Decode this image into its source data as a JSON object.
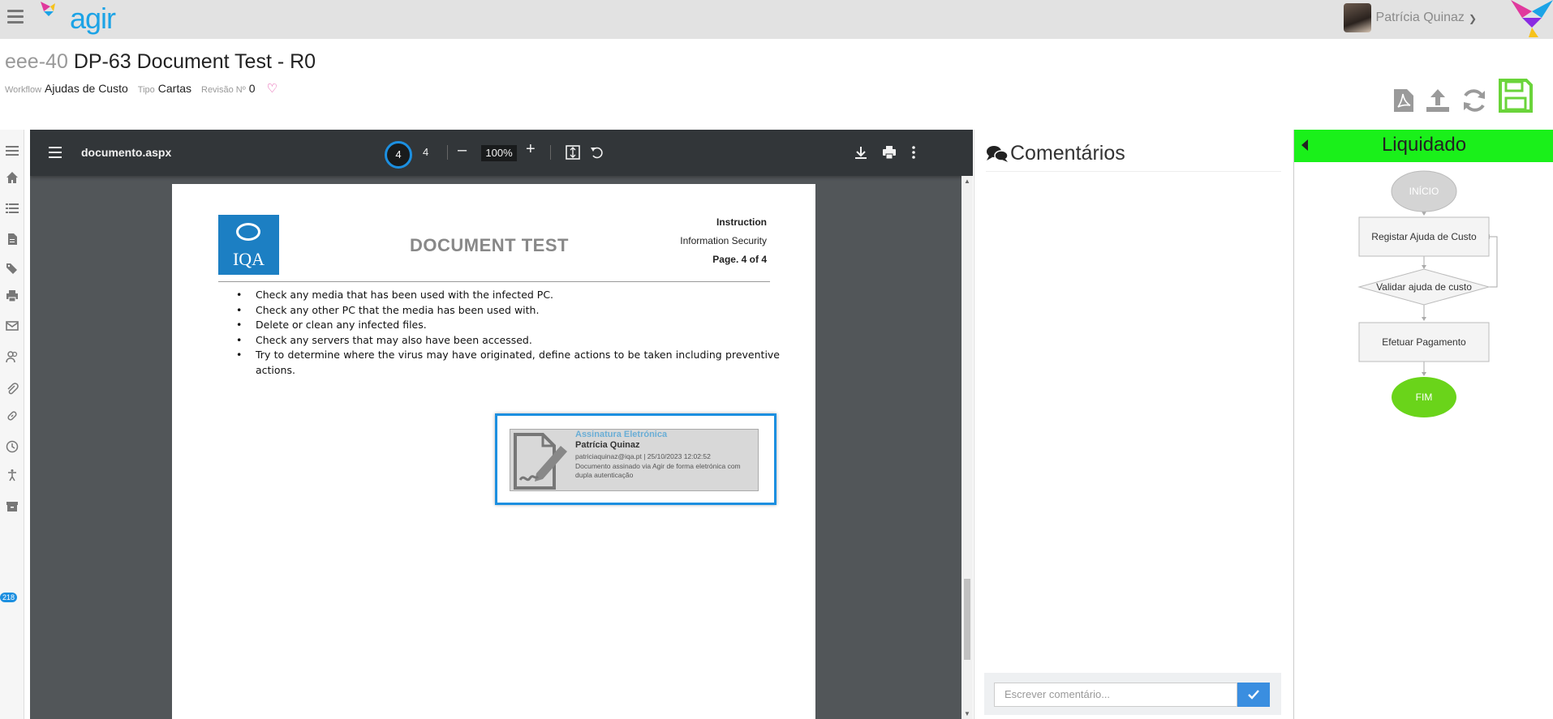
{
  "header": {
    "logo_text": "agir",
    "user_name": "Patrícia Quinaz"
  },
  "document": {
    "code": "eee-40",
    "title": "DP-63 Document Test - R0",
    "workflow_label": "Workflow",
    "workflow_value": "Ajudas de Custo",
    "type_label": "Tipo",
    "type_value": "Cartas",
    "revision_label": "Revisão Nº",
    "revision_value": "0"
  },
  "pdf_viewer": {
    "filename": "documento.aspx",
    "current_page": "4",
    "total_pages": "4",
    "zoom": "100%",
    "page": {
      "logo_text": "IQA",
      "title": "DOCUMENT TEST",
      "header_right_1": "Instruction",
      "header_right_2": "Information Security",
      "header_right_3_prefix": "Page. ",
      "header_right_3_page": "4",
      "header_right_3_mid": " of ",
      "header_right_3_total": "4",
      "bullets": [
        "Check any media that has been used with the infected PC.",
        "Check any other PC that the media has been used with.",
        "Delete or clean any infected files.",
        "Check any servers that may also have been accessed.",
        "Try to determine where the virus may have originated, define actions to be taken including preventive actions."
      ],
      "signature": {
        "title": "Assinatura Eletrónica",
        "name": "Patrícia Quinaz",
        "email_date": "patriciaquinaz@iqa.pt | 25/10/2023 12:02:52",
        "description": "Documento assinado via Agir de forma eletrónica com dupla autenticação"
      }
    }
  },
  "comments": {
    "title": "Comentários",
    "placeholder": "Escrever comentário..."
  },
  "workflow_panel": {
    "status": "Liquidado",
    "status_color": "#1af01a",
    "nodes": {
      "start": "INÍCIO",
      "step1": "Registar Ajuda de Custo",
      "decision": "Validar ajuda de custo",
      "step2": "Efetuar Pagamento",
      "end": "FIM"
    }
  },
  "left_rail": {
    "badge_count": "218",
    "icons": [
      "menu-icon",
      "home-icon",
      "list-icon",
      "document-icon",
      "tags-icon",
      "print-icon",
      "envelope-icon",
      "users-icon",
      "paperclip-icon",
      "link-icon",
      "clock-icon",
      "accessibility-icon",
      "archive-icon"
    ]
  }
}
